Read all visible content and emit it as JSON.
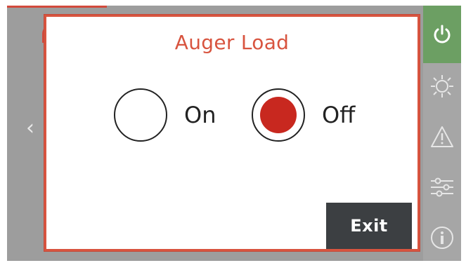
{
  "dialog": {
    "title": "Auger Load",
    "options": [
      {
        "label": "On",
        "selected": false
      },
      {
        "label": "Off",
        "selected": true
      }
    ],
    "exit_label": "Exit"
  },
  "sidebar": {
    "items": [
      {
        "icon": "power-icon"
      },
      {
        "icon": "sun-snowflake-icon"
      },
      {
        "icon": "warning-icon"
      },
      {
        "icon": "sliders-icon"
      },
      {
        "icon": "info-icon"
      }
    ]
  },
  "background": {
    "back_glyph": "‹"
  },
  "colors": {
    "accent": "#d8543f",
    "selected_radio": "#c8281f",
    "power_button": "#6c9f63",
    "exit_button": "#3c3f42",
    "screen_background": "#9d9d9d"
  }
}
